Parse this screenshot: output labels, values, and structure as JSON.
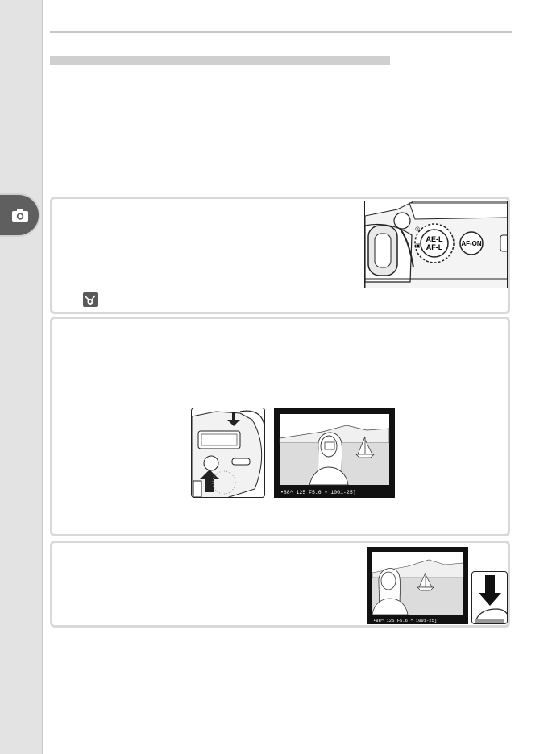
{
  "sidebar": {
    "tab_icon": "camera-icon",
    "tab_color": "#5f5f5f"
  },
  "steps": [
    {
      "illustration": "ae-l-af-l-button-illustration",
      "button_labels": [
        "AE-L AF-L",
        "AF-ON"
      ],
      "note_icon": "eye-note-icon"
    },
    {
      "illustration": "shutter-and-viewfinder-illustration",
      "viewfinder_readout": "•88ᴬ 125 F5.6 ᴬ     1001-25]"
    },
    {
      "illustration": "viewfinder-and-shutter-press-illustration",
      "viewfinder_readout": "•88ᴬ 125 F5.6 ᴬ     1001-25]"
    }
  ],
  "colors": {
    "panel_border": "#d9d9d9",
    "rule": "#c6c6c6",
    "sidebar": "#e3e3e3"
  }
}
